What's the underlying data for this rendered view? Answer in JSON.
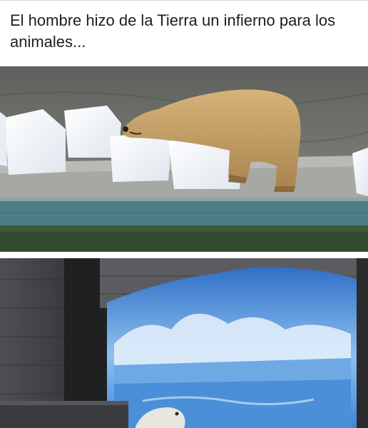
{
  "post": {
    "caption": "El hombre hizo de la Tierra un infierno para los animales..."
  },
  "images": [
    {
      "name": "polar-bear-on-ice-blocks",
      "description_visible": ""
    },
    {
      "name": "polar-bear-painted-arctic-mural",
      "description_visible": ""
    }
  ],
  "colors": {
    "text": "#1c1e21",
    "divider": "#d9d9d9",
    "ice": "#f4f7fb",
    "bear": "#c9a46a",
    "mural_blue": "#3f86d6"
  }
}
